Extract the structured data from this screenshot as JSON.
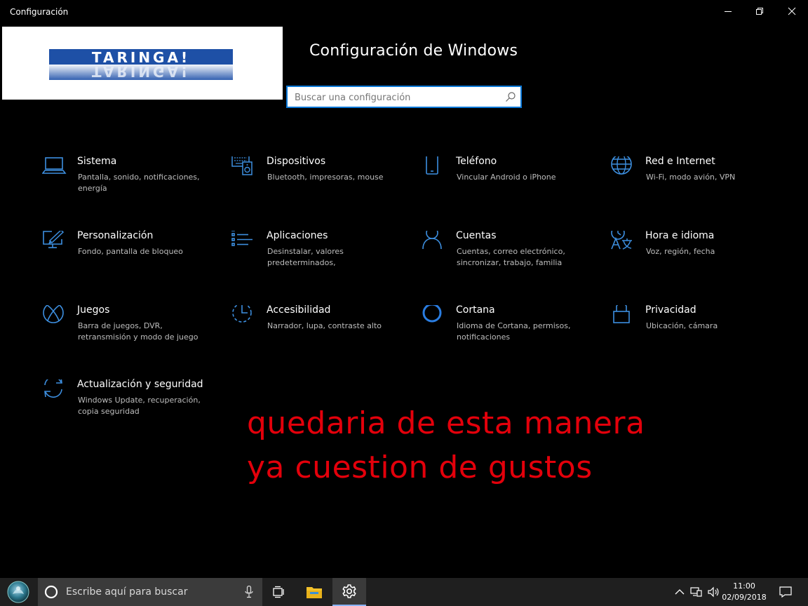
{
  "window": {
    "title": "Configuración",
    "minimize_icon": "minimize-icon",
    "restore_icon": "restore-icon",
    "close_icon": "close-icon"
  },
  "logo": {
    "text": "TARINGA!"
  },
  "header": {
    "title": "Configuración de Windows",
    "search_placeholder": "Buscar una configuración"
  },
  "categories": [
    {
      "name": "Sistema",
      "desc": "Pantalla, sonido, notificaciones, energía",
      "icon": "laptop-icon"
    },
    {
      "name": "Dispositivos",
      "desc": "Bluetooth, impresoras, mouse",
      "icon": "devices-icon"
    },
    {
      "name": "Teléfono",
      "desc": "Vincular Android o iPhone",
      "icon": "phone-icon"
    },
    {
      "name": "Red e Internet",
      "desc": "Wi-Fi, modo avión, VPN",
      "icon": "globe-icon"
    },
    {
      "name": "Personalización",
      "desc": "Fondo, pantalla de bloqueo",
      "icon": "personalization-icon"
    },
    {
      "name": "Aplicaciones",
      "desc": "Desinstalar, valores predeterminados,",
      "icon": "apps-list-icon"
    },
    {
      "name": "Cuentas",
      "desc": "Cuentas, correo electrónico, sincronizar, trabajo, familia",
      "icon": "person-icon"
    },
    {
      "name": "Hora e idioma",
      "desc": "Voz, región, fecha",
      "icon": "time-language-icon"
    },
    {
      "name": "Juegos",
      "desc": "Barra de juegos, DVR, retransmisión y modo de juego",
      "icon": "xbox-icon"
    },
    {
      "name": "Accesibilidad",
      "desc": "Narrador, lupa, contraste alto",
      "icon": "accessibility-icon"
    },
    {
      "name": "Cortana",
      "desc": "Idioma de Cortana, permisos, notificaciones",
      "icon": "cortana-icon"
    },
    {
      "name": "Privacidad",
      "desc": "Ubicación, cámara",
      "icon": "lock-icon"
    },
    {
      "name": "Actualización y seguridad",
      "desc": "Windows Update, recuperación, copia seguridad",
      "icon": "update-icon"
    }
  ],
  "annotation": {
    "line1": "quedaria de esta manera",
    "line2": "ya cuestion de gustos",
    "color": "#e3000b"
  },
  "taskbar": {
    "search_placeholder": "Escribe aquí para buscar",
    "time": "11:00",
    "date": "02/09/2018"
  },
  "colors": {
    "accent": "#0a78d7",
    "icon_blue": "#3d8fe0",
    "background": "#000000",
    "taskbar": "#1f1f1f"
  }
}
